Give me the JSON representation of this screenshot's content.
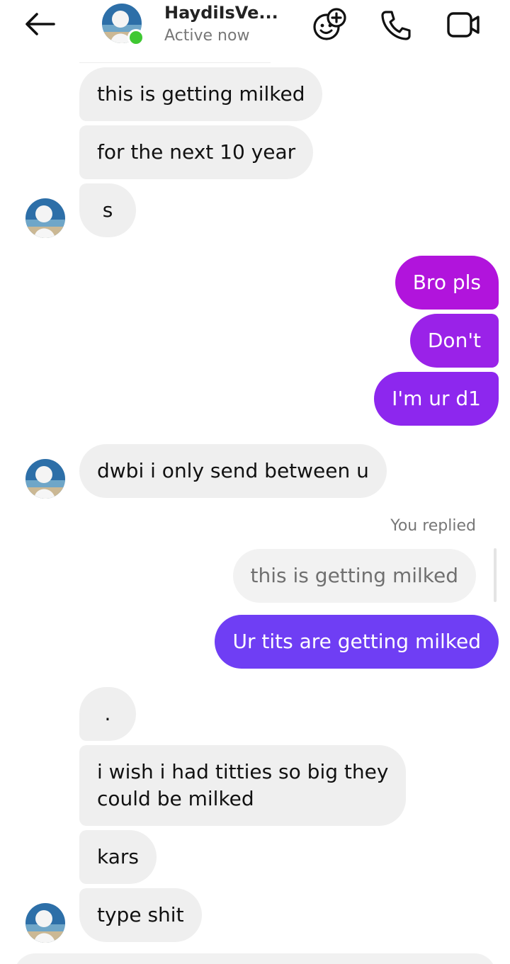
{
  "header": {
    "name": "HaydiIsVe...",
    "status": "Active now",
    "online_color": "#3fc832",
    "icons": [
      "back-arrow-icon",
      "effects-icon",
      "phone-icon",
      "video-icon"
    ]
  },
  "messages": [
    {
      "dir": "in",
      "text": "this is getting milked"
    },
    {
      "dir": "in",
      "text": "for the next 10 year"
    },
    {
      "dir": "in",
      "text": "s"
    },
    {
      "dir": "out",
      "text": "Bro pls"
    },
    {
      "dir": "out",
      "text": "Don't"
    },
    {
      "dir": "out",
      "text": "I'm ur d1"
    },
    {
      "dir": "in",
      "text": "dwbi i only send between u"
    },
    {
      "dir": "reply-label",
      "text": "You replied"
    },
    {
      "dir": "reply-quote",
      "text": "this is getting milked"
    },
    {
      "dir": "out",
      "text": "Ur tits are getting milked"
    },
    {
      "dir": "in",
      "text": "."
    },
    {
      "dir": "in",
      "line1": "i wish i had titties so big they",
      "line2": "could be milked"
    },
    {
      "dir": "in",
      "text": "kars"
    },
    {
      "dir": "in",
      "text": "type shit"
    }
  ],
  "colors": {
    "incoming_bubble": "#efefef",
    "outgoing_gradient": [
      "#b114dc",
      "#9a22e8",
      "#8d27ee",
      "#7a36f2",
      "#6f3ef4"
    ]
  }
}
